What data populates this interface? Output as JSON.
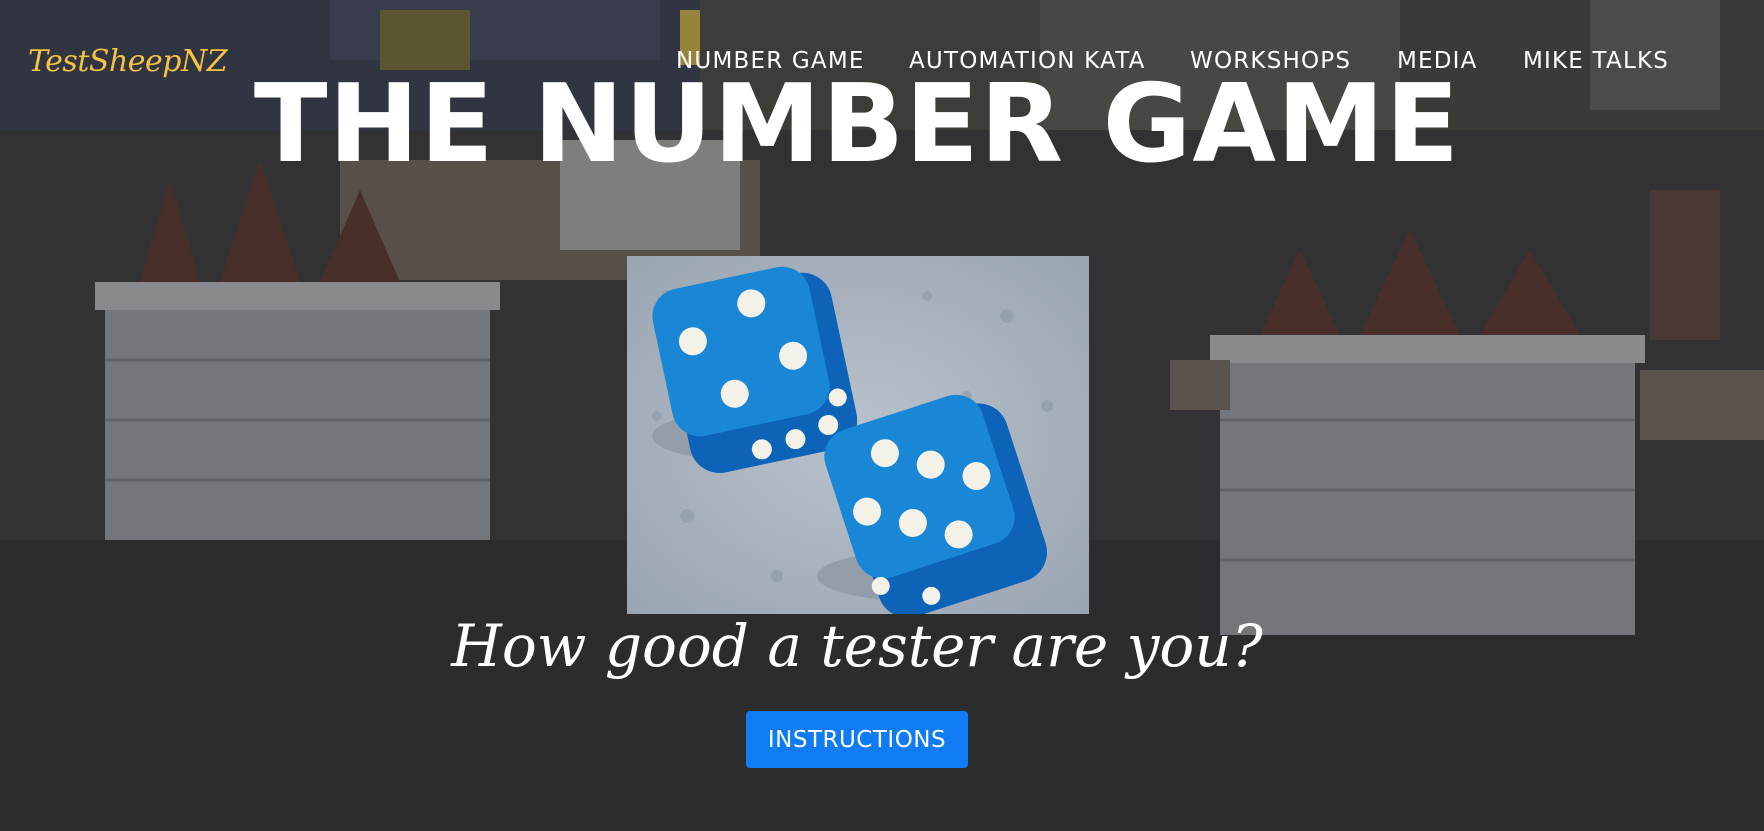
{
  "brand": {
    "name": "TestSheepNZ",
    "color": "#f5c242"
  },
  "nav": {
    "items": [
      {
        "label": "NUMBER GAME"
      },
      {
        "label": "AUTOMATION KATA"
      },
      {
        "label": "WORKSHOPS"
      },
      {
        "label": "MEDIA"
      },
      {
        "label": "MIKE TALKS"
      }
    ]
  },
  "hero": {
    "title": "THE NUMBER GAME",
    "image": {
      "icon": "dice-image"
    },
    "tagline": "How good a tester are you?",
    "cta_label": "INSTRUCTIONS",
    "cta_color": "#0f7cf6"
  }
}
